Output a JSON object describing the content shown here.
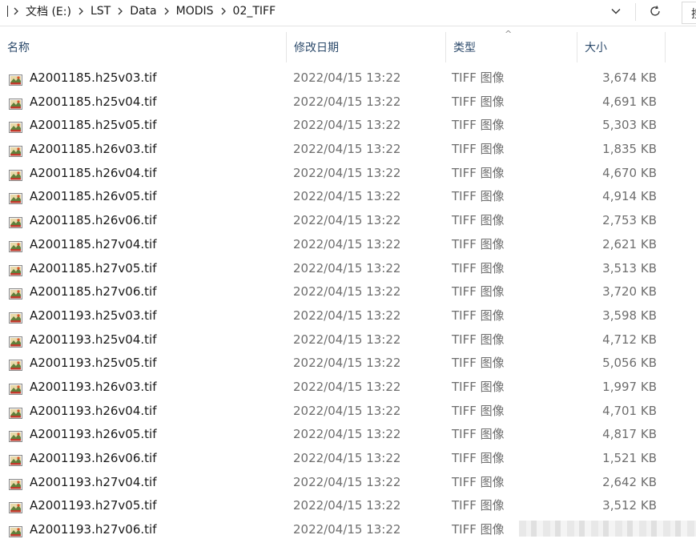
{
  "breadcrumb": {
    "items": [
      "文档 (E:)",
      "LST",
      "Data",
      "MODIS",
      "02_TIFF"
    ]
  },
  "toolbar": {
    "dropdown_icon": "chevron-down-icon",
    "refresh_icon": "refresh-icon",
    "search_glyph": "搜"
  },
  "columns": {
    "name": "名称",
    "date": "修改日期",
    "type": "类型",
    "size": "大小",
    "sort_indicator": "^"
  },
  "colors": {
    "header_text": "#2c4a6b",
    "detail_text": "#6e6e6e"
  },
  "files": [
    {
      "name": "A2001185.h25v03.tif",
      "date": "2022/04/15 13:22",
      "type": "TIFF 图像",
      "size": "3,674 KB"
    },
    {
      "name": "A2001185.h25v04.tif",
      "date": "2022/04/15 13:22",
      "type": "TIFF 图像",
      "size": "4,691 KB"
    },
    {
      "name": "A2001185.h25v05.tif",
      "date": "2022/04/15 13:22",
      "type": "TIFF 图像",
      "size": "5,303 KB"
    },
    {
      "name": "A2001185.h26v03.tif",
      "date": "2022/04/15 13:22",
      "type": "TIFF 图像",
      "size": "1,835 KB"
    },
    {
      "name": "A2001185.h26v04.tif",
      "date": "2022/04/15 13:22",
      "type": "TIFF 图像",
      "size": "4,670 KB"
    },
    {
      "name": "A2001185.h26v05.tif",
      "date": "2022/04/15 13:22",
      "type": "TIFF 图像",
      "size": "4,914 KB"
    },
    {
      "name": "A2001185.h26v06.tif",
      "date": "2022/04/15 13:22",
      "type": "TIFF 图像",
      "size": "2,753 KB"
    },
    {
      "name": "A2001185.h27v04.tif",
      "date": "2022/04/15 13:22",
      "type": "TIFF 图像",
      "size": "2,621 KB"
    },
    {
      "name": "A2001185.h27v05.tif",
      "date": "2022/04/15 13:22",
      "type": "TIFF 图像",
      "size": "3,513 KB"
    },
    {
      "name": "A2001185.h27v06.tif",
      "date": "2022/04/15 13:22",
      "type": "TIFF 图像",
      "size": "3,720 KB"
    },
    {
      "name": "A2001193.h25v03.tif",
      "date": "2022/04/15 13:22",
      "type": "TIFF 图像",
      "size": "3,598 KB"
    },
    {
      "name": "A2001193.h25v04.tif",
      "date": "2022/04/15 13:22",
      "type": "TIFF 图像",
      "size": "4,712 KB"
    },
    {
      "name": "A2001193.h25v05.tif",
      "date": "2022/04/15 13:22",
      "type": "TIFF 图像",
      "size": "5,056 KB"
    },
    {
      "name": "A2001193.h26v03.tif",
      "date": "2022/04/15 13:22",
      "type": "TIFF 图像",
      "size": "1,997 KB"
    },
    {
      "name": "A2001193.h26v04.tif",
      "date": "2022/04/15 13:22",
      "type": "TIFF 图像",
      "size": "4,701 KB"
    },
    {
      "name": "A2001193.h26v05.tif",
      "date": "2022/04/15 13:22",
      "type": "TIFF 图像",
      "size": "4,817 KB"
    },
    {
      "name": "A2001193.h26v06.tif",
      "date": "2022/04/15 13:22",
      "type": "TIFF 图像",
      "size": "1,521 KB"
    },
    {
      "name": "A2001193.h27v04.tif",
      "date": "2022/04/15 13:22",
      "type": "TIFF 图像",
      "size": "2,642 KB"
    },
    {
      "name": "A2001193.h27v05.tif",
      "date": "2022/04/15 13:22",
      "type": "TIFF 图像",
      "size": "3,512 KB"
    },
    {
      "name": "A2001193.h27v06.tif",
      "date": "2022/04/15 13:22",
      "type": "TIFF 图像",
      "size": ""
    }
  ]
}
